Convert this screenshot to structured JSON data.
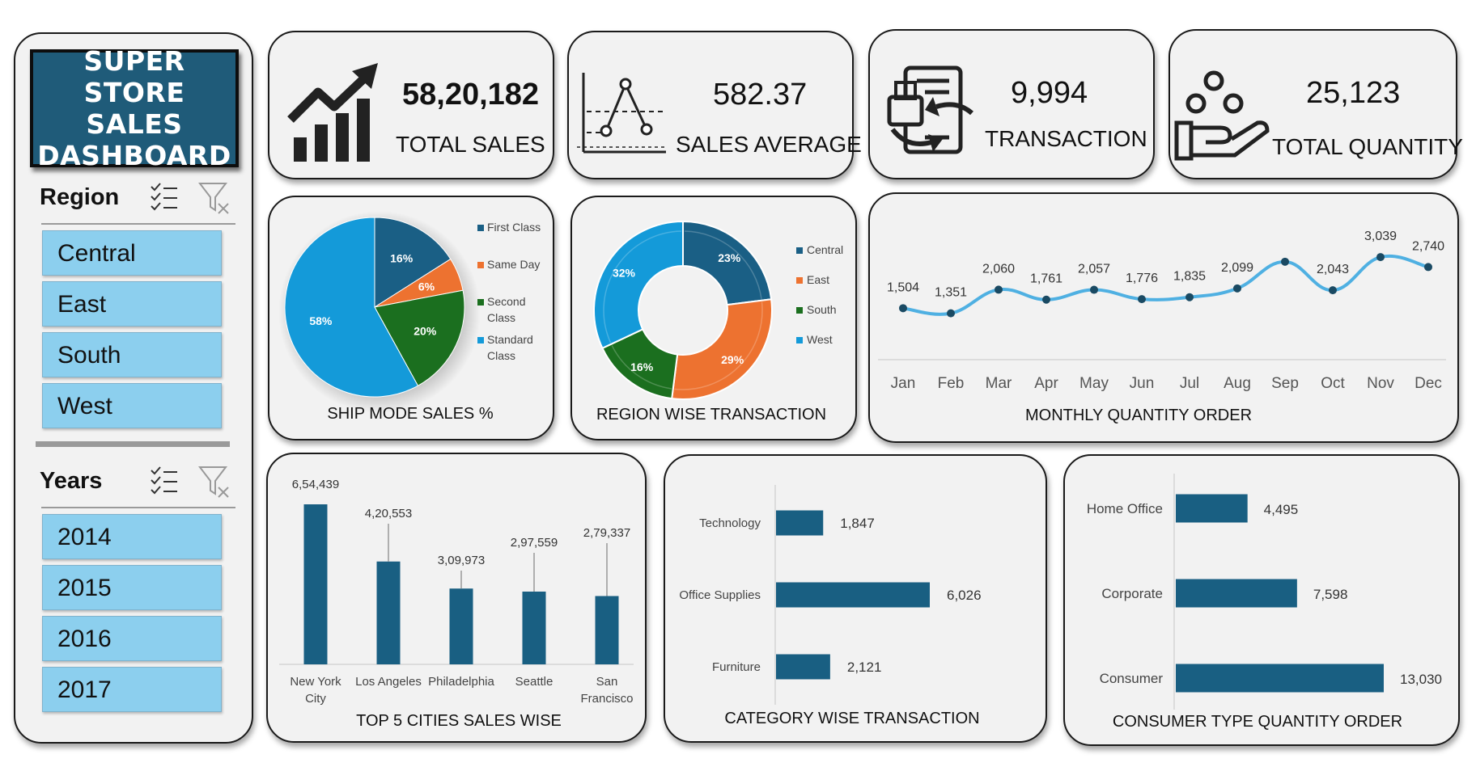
{
  "dashboard": {
    "title_lines": [
      "SUPER STORE",
      "SALES",
      "DASHBOARD"
    ]
  },
  "slicers": {
    "region": {
      "label": "Region",
      "items": [
        "Central",
        "East",
        "South",
        "West"
      ]
    },
    "years": {
      "label": "Years",
      "items": [
        "2014",
        "2015",
        "2016",
        "2017"
      ]
    }
  },
  "kpis": [
    {
      "value": "58,20,182",
      "label": "TOTAL SALES",
      "icon": "growth-chart-icon"
    },
    {
      "value": "582.37",
      "label": "SALES AVERAGE",
      "icon": "average-graph-icon"
    },
    {
      "value": "9,994",
      "label": "TRANSACTION",
      "icon": "transaction-document-icon"
    },
    {
      "value": "25,123",
      "label": "TOTAL QUANTITY",
      "icon": "hand-quantity-icon"
    }
  ],
  "colors": {
    "dark_blue": "#1a5f85",
    "orange": "#ed7230",
    "green": "#1b6f1f",
    "light_blue": "#149ad9",
    "line": "#4fb0e2",
    "bar": "#195f82",
    "panel": "#f2f2f2",
    "slicer": "#8ccfee",
    "title_box": "#1f5b79"
  },
  "chart_data": [
    {
      "id": "ship_mode",
      "type": "pie",
      "title": "SHIP MODE SALES %",
      "categories": [
        "First Class",
        "Same Day",
        "Second Class",
        "Standard Class"
      ],
      "values": [
        16,
        6,
        20,
        58
      ],
      "labels": [
        "16%",
        "6%",
        "20%",
        "58%"
      ],
      "legend": "right"
    },
    {
      "id": "region_transaction",
      "type": "pie",
      "subtype": "donut",
      "title": "REGION WISE TRANSACTION",
      "categories": [
        "Central",
        "East",
        "South",
        "West"
      ],
      "values": [
        23,
        29,
        16,
        32
      ],
      "labels": [
        "23%",
        "29%",
        "16%",
        "32%"
      ],
      "legend": "right"
    },
    {
      "id": "monthly_quantity",
      "type": "line",
      "title": "MONTHLY QUANTITY ORDER",
      "categories": [
        "Jan",
        "Feb",
        "Mar",
        "Apr",
        "May",
        "Jun",
        "Jul",
        "Aug",
        "Sep",
        "Oct",
        "Nov",
        "Dec"
      ],
      "values": [
        1504,
        1351,
        2060,
        1761,
        2057,
        1776,
        1835,
        2099,
        2900,
        2043,
        3039,
        2740
      ],
      "labels": [
        "1,504",
        "1,351",
        "2,060",
        "1,761",
        "2,057",
        "1,776",
        "1,835",
        "2,099",
        "",
        "2,043",
        "3,039",
        "2,740"
      ],
      "ylim": [
        0,
        3300
      ]
    },
    {
      "id": "top_cities",
      "type": "bar",
      "title": "TOP 5 CITIES SALES WISE",
      "categories": [
        "New York City",
        "Los Angeles",
        "Philadelphia",
        "Seattle",
        "San Francisco"
      ],
      "category_lines": [
        [
          "New York",
          "City"
        ],
        [
          "Los Angeles"
        ],
        [
          "Philadelphia"
        ],
        [
          "Seattle"
        ],
        [
          "San",
          "Francisco"
        ]
      ],
      "values": [
        654439,
        420553,
        309973,
        297559,
        279337
      ],
      "labels": [
        "6,54,439",
        "4,20,553",
        "3,09,973",
        "2,97,559",
        "2,79,337"
      ],
      "ylim": [
        0,
        654439
      ]
    },
    {
      "id": "category_transaction",
      "type": "bar",
      "orientation": "horizontal",
      "title": "CATEGORY WISE TRANSACTION",
      "categories": [
        "Technology",
        "Office Supplies",
        "Furniture"
      ],
      "values": [
        1847,
        6026,
        2121
      ],
      "labels": [
        "1,847",
        "6,026",
        "2,121"
      ],
      "xlim": [
        0,
        6026
      ]
    },
    {
      "id": "consumer_type",
      "type": "bar",
      "orientation": "horizontal",
      "title": "CONSUMER TYPE QUANTITY ORDER",
      "categories": [
        "Home Office",
        "Corporate",
        "Consumer"
      ],
      "values": [
        4495,
        7598,
        13030
      ],
      "labels": [
        "4,495",
        "7,598",
        "13,030"
      ],
      "xlim": [
        0,
        13030
      ]
    }
  ]
}
